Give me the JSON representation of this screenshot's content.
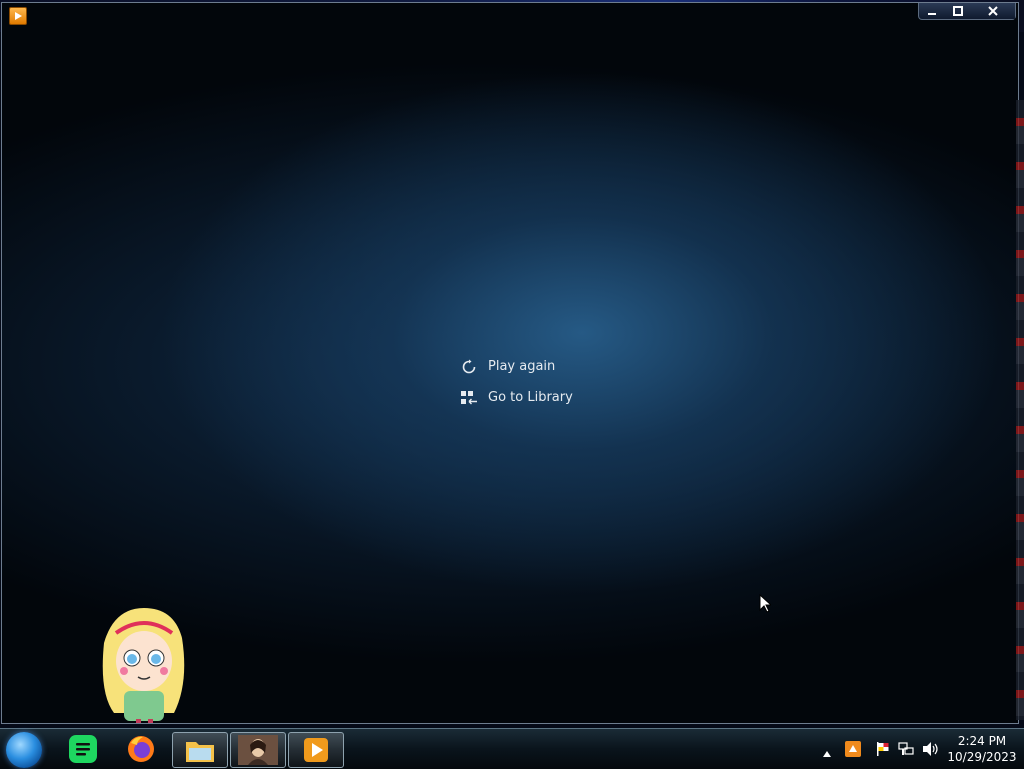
{
  "window": {
    "controls": {
      "minimize": "minimize",
      "maximize": "maximize",
      "close": "close"
    }
  },
  "menu": {
    "items": [
      {
        "label": "Play again",
        "icon": "replay-icon"
      },
      {
        "label": "Go to Library",
        "icon": "library-icon"
      }
    ]
  },
  "taskbar": {
    "pinned": [
      "start-orb",
      "spotify",
      "firefox",
      "file-explorer",
      "photo-app",
      "media-player"
    ],
    "clock": {
      "time": "2:24 PM",
      "date": "10/29/2023"
    }
  },
  "colors": {
    "background_glow": "#1f4f78",
    "menu_text": "#e6ebf0",
    "spotify_green": "#1ed760",
    "firefox_orange": "#ff7a18"
  }
}
